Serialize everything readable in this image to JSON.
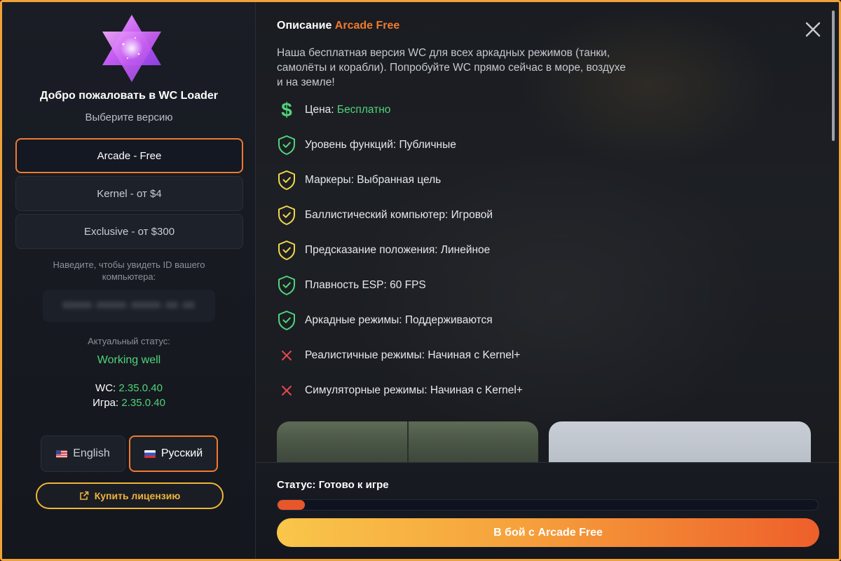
{
  "colors": {
    "accent_orange": "#f07a2e",
    "status_green": "#4fd47a",
    "gold": "#f0b43a",
    "shield_green": "#4fd47a",
    "shield_yellow": "#f2d64b",
    "cross_red": "#e5484d"
  },
  "sidebar": {
    "welcome": "Добро пожаловать в WC Loader",
    "choose_version": "Выберите версию",
    "versions": [
      {
        "label": "Arcade - Free",
        "selected": true
      },
      {
        "label": "Kernel - от $4",
        "selected": false
      },
      {
        "label": "Exclusive - от $300",
        "selected": false
      }
    ],
    "hwid_hint": "Наведите, чтобы увидеть ID вашего компьютера:",
    "status_label": "Актуальный статус:",
    "status_value": "Working well",
    "wc_label": "WC:",
    "wc_version": "2.35.0.40",
    "game_label": "Игра:",
    "game_version": "2.35.0.40",
    "languages": [
      {
        "label": "English",
        "flag": "us-flag-icon",
        "selected": false
      },
      {
        "label": "Русский",
        "flag": "ru-flag-icon",
        "selected": true
      }
    ],
    "buy_license": "Купить лицензию",
    "buy_icon": "external-link-icon"
  },
  "main": {
    "title_prefix": "Описание",
    "title_accent": "Arcade Free",
    "description": "Наша бесплатная версия WC для всех аркадных режимов (танки, самолёты и корабли). Попробуйте WC прямо сейчас в море, воздухе и на земле!",
    "features": [
      {
        "icon": "dollar-icon",
        "label": "Цена: ",
        "value": "Бесплатно"
      },
      {
        "icon": "shield-check-green-icon",
        "label": "Уровень функций: Публичные"
      },
      {
        "icon": "shield-check-yellow-icon",
        "label": "Маркеры: Выбранная цель"
      },
      {
        "icon": "shield-check-yellow-icon",
        "label": "Баллистический компьютер: Игровой"
      },
      {
        "icon": "shield-check-yellow-icon",
        "label": "Предсказание положения: Линейное"
      },
      {
        "icon": "shield-check-green-icon",
        "label": "Плавность ESP: 60 FPS"
      },
      {
        "icon": "shield-check-green-icon",
        "label": "Аркадные режимы: Поддерживаются"
      },
      {
        "icon": "cross-icon",
        "label": "Реалистичные режимы: Начиная с Kernel+"
      },
      {
        "icon": "cross-icon",
        "label": "Симуляторные режимы: Начиная с Kernel+"
      }
    ],
    "game_status": "Статус: Готово к игре",
    "progress": 0.05,
    "play_button": "В бой с Arcade Free",
    "close_icon": "close-icon"
  }
}
